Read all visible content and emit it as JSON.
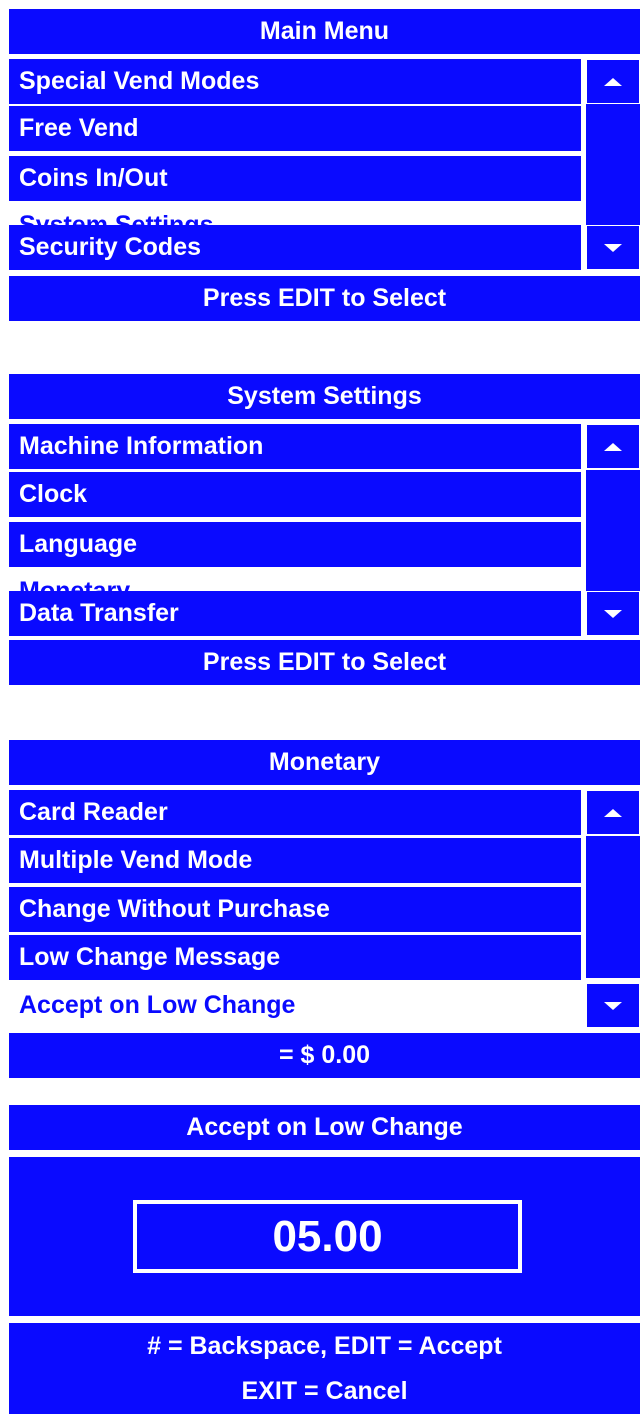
{
  "panels": [
    {
      "title": "Main Menu",
      "items": [
        "Special Vend Modes",
        "Free Vend",
        "Coins In/Out",
        "System Settings",
        "Security Codes"
      ],
      "footer": "Press EDIT to Select"
    },
    {
      "title": "System Settings",
      "items": [
        "Machine Information",
        "Clock",
        "Language",
        "Monetary",
        "Data Transfer"
      ],
      "footer": "Press EDIT to Select"
    },
    {
      "title": "Monetary",
      "items": [
        "Card Reader",
        "Multiple Vend Mode",
        "Change Without Purchase",
        "Low Change Message",
        "Accept on Low Change"
      ],
      "footer": "= $ 0.00"
    }
  ],
  "edit_panel": {
    "title": "Accept on Low Change",
    "value": "05.00",
    "hint_line1": "# = Backspace, EDIT = Accept",
    "hint_line2": "EXIT = Cancel"
  },
  "colors": {
    "screen_blue": "#0a0aff",
    "highlight": "#ffffff"
  },
  "icons": {
    "scroll_up": "triangle-up-icon",
    "scroll_down": "triangle-down-icon"
  }
}
